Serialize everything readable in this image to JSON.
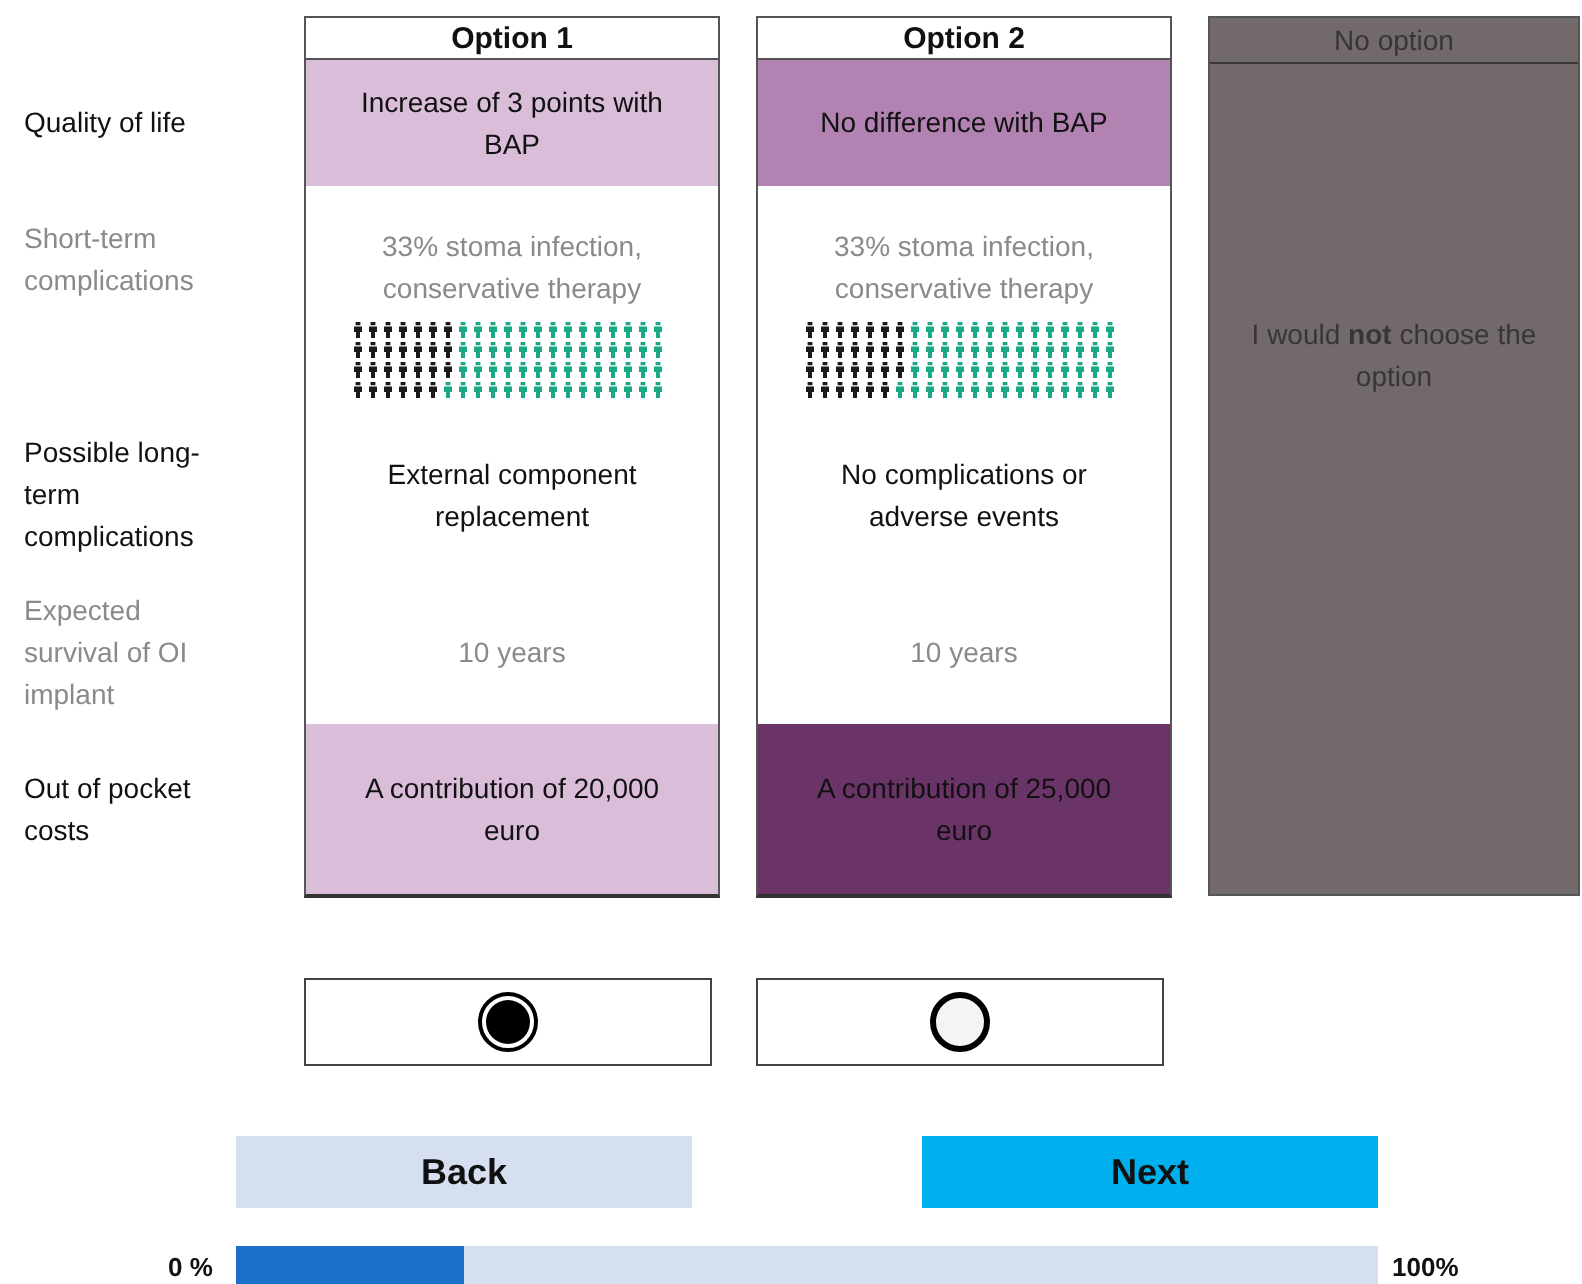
{
  "attributes": [
    {
      "label": "Quality of life",
      "dimmed": false
    },
    {
      "label": "Short-term complications",
      "dimmed": true
    },
    {
      "label": "Possible long-term complications",
      "dimmed": false
    },
    {
      "label": "Expected survival of OI implant",
      "dimmed": true
    },
    {
      "label": "Out of pocket costs",
      "dimmed": false
    }
  ],
  "options": [
    {
      "title": "Option 1",
      "selected": true,
      "cells": [
        {
          "text": "Increase of 3 points with BAP",
          "color": "#d9bdd9"
        },
        {
          "text": "33% stoma infection, conservative therapy",
          "kind": "pictogram"
        },
        {
          "text": "External component replacement"
        },
        {
          "text": "10 years"
        },
        {
          "text": "A contribution of 20,000 euro",
          "color": "#d9bdd9"
        }
      ]
    },
    {
      "title": "Option 2",
      "selected": false,
      "cells": [
        {
          "text": "No difference with BAP",
          "color": "#b282b2"
        },
        {
          "text": "33% stoma infection, conservative therapy",
          "kind": "pictogram"
        },
        {
          "text": "No complications or adverse events"
        },
        {
          "text": "10 years"
        },
        {
          "text": "A contribution of 25,000 euro",
          "color": "#6b3468"
        }
      ]
    }
  ],
  "no_option": {
    "title": "No option",
    "text": "I would **not** choose the option"
  },
  "buttons": [
    {
      "label": "Back",
      "kind": "back"
    },
    {
      "label": "Next",
      "kind": "next"
    }
  ],
  "progress": {
    "start": "0 %",
    "end": "100%",
    "level": 0.2
  }
}
